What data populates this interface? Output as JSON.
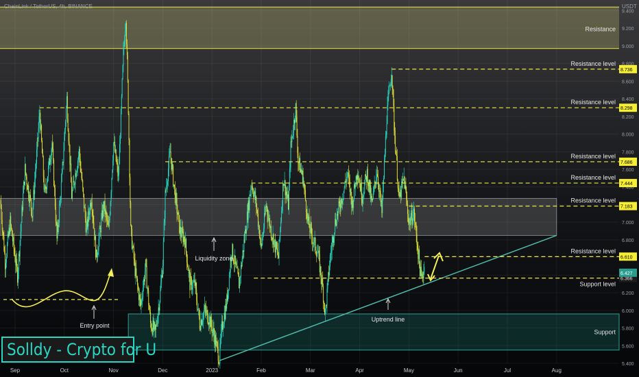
{
  "chart_data": {
    "type": "candlestick",
    "title": "ChainLink / TetherUS, 4h, BINANCE",
    "currency": "USDT",
    "ylim": [
      5.4,
      9.52
    ],
    "y_ticks": [
      5.4,
      5.6,
      5.8,
      6.0,
      6.2,
      6.4,
      6.6,
      6.8,
      7.0,
      7.2,
      7.4,
      7.6,
      7.8,
      8.0,
      8.2,
      8.4,
      8.6,
      8.8,
      9.0,
      9.2,
      9.4
    ],
    "x_ticks": [
      {
        "label": "Sep",
        "t": 0.0
      },
      {
        "label": "Oct",
        "t": 1.0
      },
      {
        "label": "Nov",
        "t": 2.0
      },
      {
        "label": "Dec",
        "t": 3.0
      },
      {
        "label": "2023",
        "t": 4.0
      },
      {
        "label": "Feb",
        "t": 5.0
      },
      {
        "label": "Mar",
        "t": 6.0
      },
      {
        "label": "Apr",
        "t": 7.0
      },
      {
        "label": "May",
        "t": 8.0
      },
      {
        "label": "Jun",
        "t": 9.0
      },
      {
        "label": "Jul",
        "t": 10.0
      },
      {
        "label": "Aug",
        "t": 11.0
      }
    ],
    "price_path": [
      [
        -0.3,
        7.25
      ],
      [
        -0.2,
        6.55
      ],
      [
        -0.1,
        7.0
      ],
      [
        0.05,
        6.4
      ],
      [
        0.2,
        7.6
      ],
      [
        0.35,
        7.1
      ],
      [
        0.5,
        8.25
      ],
      [
        0.6,
        7.3
      ],
      [
        0.75,
        7.9
      ],
      [
        0.85,
        6.8
      ],
      [
        0.95,
        7.5
      ],
      [
        1.05,
        8.4
      ],
      [
        1.15,
        7.3
      ],
      [
        1.3,
        7.8
      ],
      [
        1.45,
        6.9
      ],
      [
        1.55,
        7.3
      ],
      [
        1.65,
        6.6
      ],
      [
        1.8,
        7.2
      ],
      [
        1.9,
        6.9
      ],
      [
        2.0,
        7.9
      ],
      [
        2.1,
        7.5
      ],
      [
        2.2,
        8.9
      ],
      [
        2.25,
        9.35
      ],
      [
        2.3,
        8.3
      ],
      [
        2.35,
        6.9
      ],
      [
        2.45,
        6.4
      ],
      [
        2.55,
        6.05
      ],
      [
        2.65,
        6.5
      ],
      [
        2.75,
        5.85
      ],
      [
        2.85,
        5.75
      ],
      [
        2.95,
        6.2
      ],
      [
        3.0,
        6.55
      ],
      [
        3.05,
        7.3
      ],
      [
        3.15,
        7.8
      ],
      [
        3.25,
        7.3
      ],
      [
        3.35,
        6.9
      ],
      [
        3.45,
        6.8
      ],
      [
        3.55,
        6.3
      ],
      [
        3.65,
        6.3
      ],
      [
        3.75,
        5.85
      ],
      [
        3.85,
        6.0
      ],
      [
        3.95,
        5.9
      ],
      [
        4.05,
        5.7
      ],
      [
        4.15,
        5.45
      ],
      [
        4.2,
        5.8
      ],
      [
        4.3,
        6.1
      ],
      [
        4.4,
        6.7
      ],
      [
        4.55,
        6.3
      ],
      [
        4.7,
        7.0
      ],
      [
        4.8,
        7.45
      ],
      [
        4.9,
        7.2
      ],
      [
        5.0,
        6.7
      ],
      [
        5.1,
        7.2
      ],
      [
        5.2,
        6.9
      ],
      [
        5.35,
        6.6
      ],
      [
        5.45,
        7.5
      ],
      [
        5.55,
        7.2
      ],
      [
        5.6,
        7.85
      ],
      [
        5.7,
        8.3
      ],
      [
        5.75,
        7.7
      ],
      [
        5.85,
        7.5
      ],
      [
        5.95,
        7.0
      ],
      [
        6.05,
        6.8
      ],
      [
        6.15,
        6.65
      ],
      [
        6.25,
        6.25
      ],
      [
        6.3,
        5.95
      ],
      [
        6.4,
        6.6
      ],
      [
        6.5,
        7.0
      ],
      [
        6.65,
        7.3
      ],
      [
        6.75,
        7.55
      ],
      [
        6.85,
        7.2
      ],
      [
        6.95,
        7.6
      ],
      [
        7.05,
        7.3
      ],
      [
        7.15,
        7.55
      ],
      [
        7.25,
        7.2
      ],
      [
        7.35,
        7.6
      ],
      [
        7.45,
        7.1
      ],
      [
        7.55,
        8.2
      ],
      [
        7.65,
        8.75
      ],
      [
        7.7,
        8.1
      ],
      [
        7.8,
        7.25
      ],
      [
        7.9,
        7.5
      ],
      [
        8.0,
        7.0
      ],
      [
        8.1,
        7.1
      ],
      [
        8.2,
        6.6
      ],
      [
        8.25,
        6.35
      ],
      [
        8.32,
        6.5
      ]
    ],
    "annotations": {
      "resistance_zone_top": {
        "label": "Resistance",
        "y_low": 8.97,
        "y_high": 9.44
      },
      "resistance_levels": [
        {
          "label": "Resistance level",
          "value": 8.736,
          "value_label": "8.736",
          "t_start": 7.65
        },
        {
          "label": "Resistance level",
          "value": 8.298,
          "value_label": "8.298",
          "t_start": 0.5
        },
        {
          "label": "Resistance level",
          "value": 7.686,
          "value_label": "7.686",
          "t_start": 3.05
        },
        {
          "label": "Resistance level",
          "value": 7.444,
          "value_label": "7.444",
          "t_start": 4.8
        },
        {
          "label": "Resistance level",
          "value": 7.183,
          "value_label": "7.183",
          "t_start": 8.0
        },
        {
          "label": "Resistance level",
          "value": 6.61,
          "value_label": "6.610",
          "t_start": 8.32
        }
      ],
      "support_level": {
        "label": "Support level",
        "value": 6.366,
        "value_label": "6.366",
        "t_start": 4.85
      },
      "current_price": {
        "value": 6.427,
        "value_label": "6.427"
      },
      "liquidity_zone": {
        "label": "Liquidity zone",
        "y_low": 6.85,
        "y_high": 7.27,
        "t_end": 11.0
      },
      "support_zone": {
        "label": "Support",
        "y_low": 5.55,
        "y_high": 5.96,
        "t_start": 2.3
      },
      "uptrend_line": {
        "label": "Uptrend line",
        "from": [
          4.15,
          5.43
        ],
        "to": [
          11.0,
          6.85
        ]
      },
      "entry_point": {
        "label": "Entry point"
      }
    },
    "colors": {
      "background": "#0b0d14",
      "bull": "#26e0c9",
      "bear": "#e8e83a",
      "level": "#f0e649",
      "trend": "#4fb8a9",
      "label_box": "#f7ef34",
      "text": "#e6e6e6"
    }
  },
  "branding": {
    "text": "Solldy - Crypto for U"
  }
}
